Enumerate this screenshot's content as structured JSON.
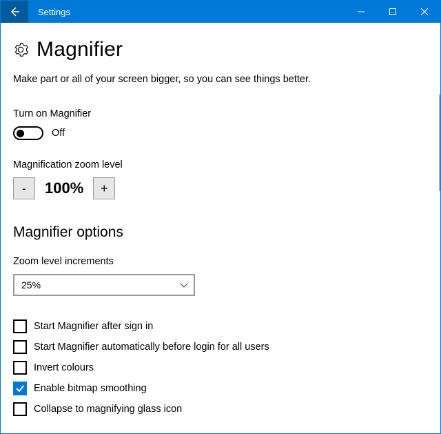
{
  "window": {
    "title": "Settings"
  },
  "page": {
    "heading": "Magnifier",
    "subheading": "Make part or all of your screen bigger, so you can see things better."
  },
  "toggle": {
    "label": "Turn on Magnifier",
    "state_text": "Off",
    "on": false
  },
  "zoom": {
    "label": "Magnification zoom level",
    "minus": "-",
    "plus": "+",
    "value": "100%"
  },
  "options": {
    "heading": "Magnifier options",
    "increments_label": "Zoom level increments",
    "increments_value": "25%",
    "checkboxes": [
      {
        "label": "Start Magnifier after sign in",
        "checked": false
      },
      {
        "label": "Start Magnifier automatically before login for all users",
        "checked": false
      },
      {
        "label": "Invert colours",
        "checked": false
      },
      {
        "label": "Enable bitmap smoothing",
        "checked": true
      },
      {
        "label": "Collapse to magnifying glass icon",
        "checked": false
      }
    ]
  }
}
